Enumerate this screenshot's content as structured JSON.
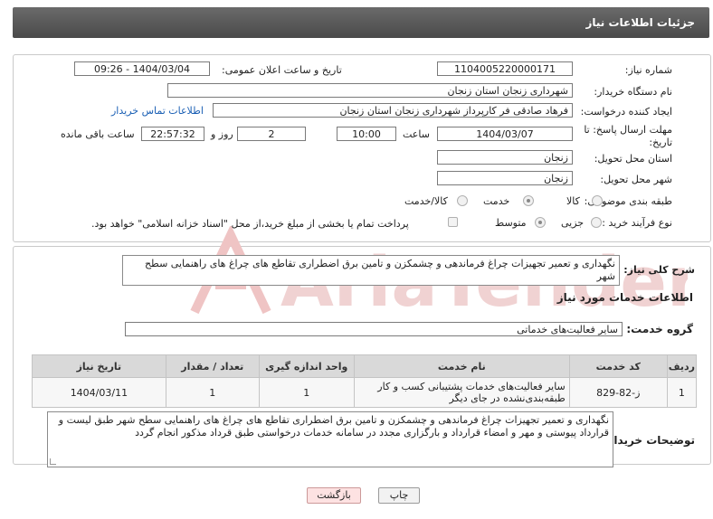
{
  "header": {
    "title": "جزئیات اطلاعات نیاز"
  },
  "fields": {
    "need_number_label": "شماره نیاز:",
    "need_number": "1104005220000171",
    "announce_label": "تاریخ و ساعت اعلان عمومی:",
    "announce_value": "1404/03/04 - 09:26",
    "buyer_label": "نام دستگاه خریدار:",
    "buyer": "شهرداری زنجان استان زنجان",
    "creator_label": "ایجاد کننده درخواست:",
    "creator": "فرهاد صادقی فر کارپرداز شهرداری زنجان استان زنجان",
    "contact_link": "اطلاعات تماس خریدار",
    "deadline_label_1": "مهلت ارسال پاسخ: تا",
    "deadline_label_2": "تاریخ:",
    "deadline_date": "1404/03/07",
    "time_label": "ساعت",
    "deadline_time": "10:00",
    "days_value": "2",
    "days_label": "روز و",
    "remaining_time": "22:57:32",
    "remaining_label": "ساعت باقی مانده",
    "province_label": "استان محل تحویل:",
    "province": "زنجان",
    "city_label": "شهر محل تحویل:",
    "city": "زنجان",
    "category_label": "طبقه بندی موضوعی:",
    "category_options": [
      "کالا",
      "خدمت",
      "کالا/خدمت"
    ],
    "category_selected": "خدمت",
    "process_label": "نوع فرآیند خرید :",
    "process_options": [
      "جزیی",
      "متوسط"
    ],
    "process_selected": "متوسط",
    "payment_note": "پرداخت تمام یا بخشی از مبلغ خرید،از محل \"اسناد خزانه اسلامی\" خواهد بود."
  },
  "summary": {
    "label": "شرح کلی نیاز:",
    "text": "نگهداری و تعمیر تجهیزات چراغ فرماندهی و چشمکزن و تامین برق اضطراری تقاطع های چراغ های راهنمایی سطح شهر"
  },
  "services": {
    "section_title": "اطلاعات خدمات مورد نیاز",
    "group_label": "گروه خدمت:",
    "group_value": "سایر فعالیت‌های خدماتی",
    "columns": [
      "ردیف",
      "کد خدمت",
      "نام خدمت",
      "واحد اندازه گیری",
      "تعداد / مقدار",
      "تاریخ نیاز"
    ],
    "rows": [
      [
        "1",
        "ز-82-829",
        "سایر فعالیت‌های خدمات پشتیبانی کسب و کار طبقه‌بندی‌نشده در جای دیگر",
        "1",
        "1",
        "1404/03/11"
      ]
    ]
  },
  "buyer_notes": {
    "label": "توضیحات خریدار:",
    "text": "نگهداری و تعمیر تجهیزات چراغ فرماندهی و چشمکزن و تامین برق اضطراری تقاطع های چراغ های راهنمایی سطح شهر طبق لیست و قرارداد پیوستی و مهر و امضاء قرارداد و بارگزاری مجدد در سامانه خدمات درخواستی طبق قرداد مذکور انجام گردد"
  },
  "buttons": {
    "print": "چاپ",
    "back": "بازگشت"
  },
  "watermark": {
    "text": "AriaTender.neT"
  },
  "colors": {
    "header_bg": "#555555",
    "link": "#1a5fb4",
    "watermark": "#e8b4b4"
  }
}
